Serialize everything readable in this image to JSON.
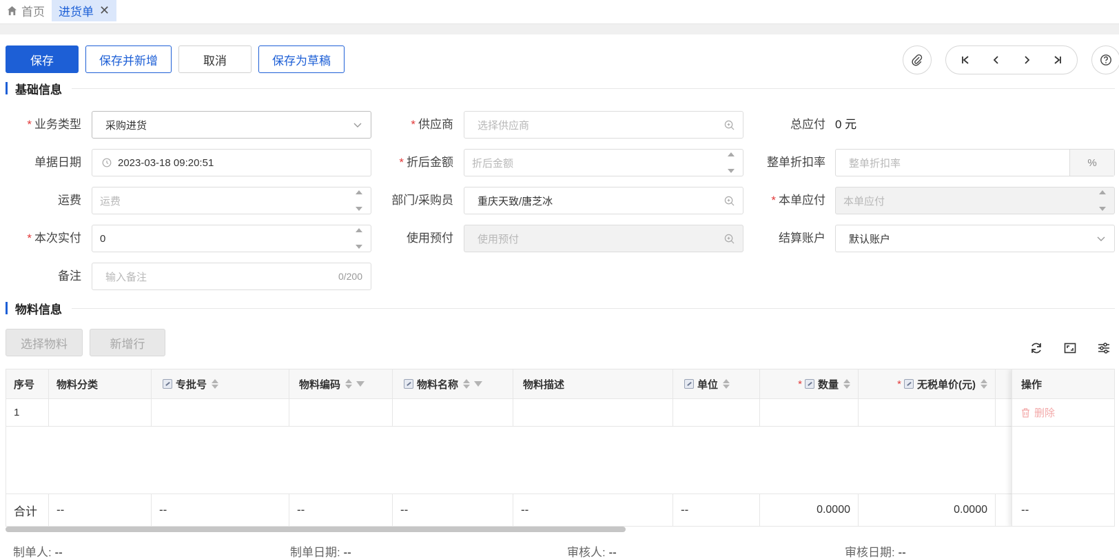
{
  "tabs": [
    {
      "label": "首页",
      "icon": "home-icon"
    },
    {
      "label": "进货单",
      "closable": true
    }
  ],
  "toolbar": {
    "save": "保存",
    "save_and_new": "保存并新增",
    "cancel": "取消",
    "save_draft": "保存为草稿"
  },
  "sections": {
    "basic": "基础信息",
    "material": "物料信息"
  },
  "form": {
    "biz_type": {
      "label": "业务类型",
      "value": "采购进货",
      "required": true
    },
    "supplier": {
      "label": "供应商",
      "placeholder": "选择供应商",
      "required": true
    },
    "total_payable": {
      "label": "总应付",
      "value": "0 元"
    },
    "doc_date": {
      "label": "单据日期",
      "value": "2023-03-18 09:20:51"
    },
    "discount_amount": {
      "label": "折后金额",
      "placeholder": "折后金额",
      "required": true
    },
    "whole_discount": {
      "label": "整单折扣率",
      "placeholder": "整单折扣率",
      "suffix": "%"
    },
    "freight": {
      "label": "运费",
      "placeholder": "运费"
    },
    "dept_buyer": {
      "label": "部门/采购员",
      "value": "重庆天致/唐芝冰"
    },
    "this_payable": {
      "label": "本单应付",
      "placeholder": "本单应付",
      "required": true
    },
    "actual_paid": {
      "label": "本次实付",
      "value": "0",
      "required": true
    },
    "use_prepay": {
      "label": "使用预付",
      "placeholder": "使用预付"
    },
    "settle_account": {
      "label": "结算账户",
      "value": "默认账户"
    },
    "remark": {
      "label": "备注",
      "placeholder": "输入备注",
      "counter": "0/200"
    }
  },
  "material_buttons": {
    "select": "选择物料",
    "add_row": "新增行"
  },
  "table": {
    "columns": {
      "seq": "序号",
      "category": "物料分类",
      "batch": "专批号",
      "code": "物料编码",
      "name": "物料名称",
      "desc": "物料描述",
      "unit": "单位",
      "qty": "数量",
      "price": "无税单价(元)",
      "op": "操作"
    },
    "rows": [
      {
        "seq": "1",
        "delete": "删除"
      }
    ],
    "footer": {
      "label": "合计",
      "dash": "--",
      "qty": "0.0000",
      "price": "0.0000"
    }
  },
  "meta": {
    "creator_label": "制单人:",
    "creator": "--",
    "create_date_label": "制单日期:",
    "create_date": "--",
    "reviewer_label": "审核人:",
    "reviewer": "--",
    "review_date_label": "审核日期:",
    "review_date": "--"
  },
  "colors": {
    "primary": "#1d5fd6",
    "required": "#e23a3a",
    "danger_disabled": "#f3a9a9"
  }
}
